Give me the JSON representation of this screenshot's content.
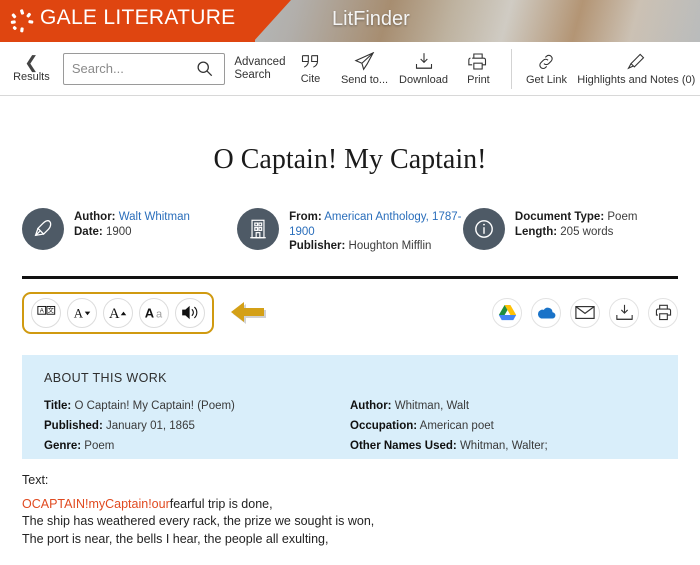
{
  "banner": {
    "brand": "GALE LITERATURE",
    "product": "LitFinder",
    "logo_icon": "gale-starburst-icon",
    "brand_color": "#df4510"
  },
  "toolbar": {
    "results_label": "Results",
    "back_icon": "chevron-left-icon",
    "search": {
      "placeholder": "Search...",
      "value": "",
      "icon": "search-icon"
    },
    "advanced_search_label": "Advanced Search",
    "items": [
      {
        "label": "Cite",
        "icon": "quote-icon"
      },
      {
        "label": "Send to...",
        "icon": "paper-plane-icon"
      },
      {
        "label": "Download",
        "icon": "download-tray-icon"
      },
      {
        "label": "Print",
        "icon": "printer-icon"
      },
      {
        "label": "Get Link",
        "icon": "link-chain-icon"
      },
      {
        "label": "Highlights and Notes (0)",
        "icon": "highlighter-pen-icon"
      }
    ]
  },
  "document": {
    "title": "O Captain! My Captain!",
    "meta": [
      {
        "icon": "quill-pen-icon",
        "lines": [
          {
            "label": "Author:",
            "value": "Walt Whitman",
            "link": true
          },
          {
            "label": "Date:",
            "value": "1900",
            "link": false
          }
        ]
      },
      {
        "icon": "building-icon",
        "lines": [
          {
            "label": "From:",
            "value": "American Anthology, 1787-1900",
            "link": true
          },
          {
            "label": "Publisher:",
            "value": "Houghton Mifflin",
            "link": false
          }
        ]
      },
      {
        "icon": "info-circle-icon",
        "lines": [
          {
            "label": "Document Type:",
            "value": "Poem",
            "link": false
          },
          {
            "label": "Length:",
            "value": "205 words",
            "link": false
          }
        ]
      }
    ]
  },
  "tools": {
    "highlight_color": "#d09a10",
    "arrow_icon": "left-arrow-annotation",
    "reading_tools": [
      {
        "name": "translate-icon",
        "label": "Translate"
      },
      {
        "name": "decrease-font-icon",
        "label": "A▾"
      },
      {
        "name": "increase-font-icon",
        "label": "A▴"
      },
      {
        "name": "display-options-icon",
        "label": "Aa"
      },
      {
        "name": "listen-speaker-icon",
        "label": "Listen"
      }
    ],
    "share_tools": [
      {
        "name": "google-drive-icon",
        "label": "Send to Google Drive"
      },
      {
        "name": "onedrive-cloud-icon",
        "label": "Send to OneDrive"
      },
      {
        "name": "email-envelope-icon",
        "label": "Email"
      },
      {
        "name": "download-icon",
        "label": "Download"
      },
      {
        "name": "print-icon",
        "label": "Print"
      }
    ]
  },
  "about": {
    "heading": "ABOUT THIS WORK",
    "background_color": "#d9eefa",
    "left": [
      {
        "label": "Title:",
        "value": "O Captain! My Captain! (Poem)"
      },
      {
        "label": "Published:",
        "value": "January 01, 1865"
      },
      {
        "label": "Genre:",
        "value": "Poem"
      }
    ],
    "right": [
      {
        "label": "Author:",
        "value": "Whitman, Walt"
      },
      {
        "label": "Occupation:",
        "value": "American poet"
      },
      {
        "label": "Other Names Used:",
        "value": "Whitman, Walter;"
      }
    ]
  },
  "body": {
    "text_label": "Text:",
    "highlight_color": "#e04a20",
    "first_line_highlight": "OCAPTAIN!myCaptain!our",
    "first_line_rest": "fearful trip is done,",
    "lines": [
      "The ship has weathered every rack, the prize we sought is won,",
      "The port is near, the bells I hear, the people all exulting,"
    ]
  }
}
